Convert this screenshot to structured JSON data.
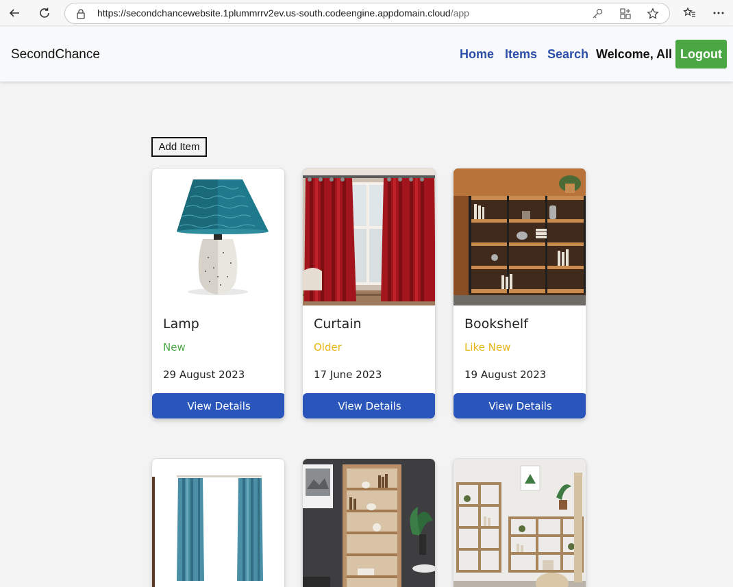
{
  "browser": {
    "url_host": "https://secondchancewebsite.1plummrrv2ev.us-south.codeengine.appdomain.cloud",
    "url_path": "/app"
  },
  "navbar": {
    "brand": "SecondChance",
    "links": [
      "Home",
      "Items",
      "Search"
    ],
    "welcome": "Welcome, All",
    "logout_label": "Logout"
  },
  "main": {
    "add_item_label": "Add Item",
    "view_details_label": "View Details",
    "items": [
      {
        "name": "Lamp",
        "condition": "New",
        "condition_color": "#4aa744",
        "date": "29 August 2023",
        "image": "lamp"
      },
      {
        "name": "Curtain",
        "condition": "Older",
        "condition_color": "#e7b416",
        "date": "17 June 2023",
        "image": "red-curtain"
      },
      {
        "name": "Bookshelf",
        "condition": "Like New",
        "condition_color": "#e7b416",
        "date": "19 August 2023",
        "image": "bookshelf"
      },
      {
        "name": "",
        "condition": "",
        "date": "",
        "image": "blue-curtain"
      },
      {
        "name": "",
        "condition": "",
        "date": "",
        "image": "tall-bookshelf"
      },
      {
        "name": "",
        "condition": "",
        "date": "",
        "image": "shelving-unit"
      }
    ]
  }
}
